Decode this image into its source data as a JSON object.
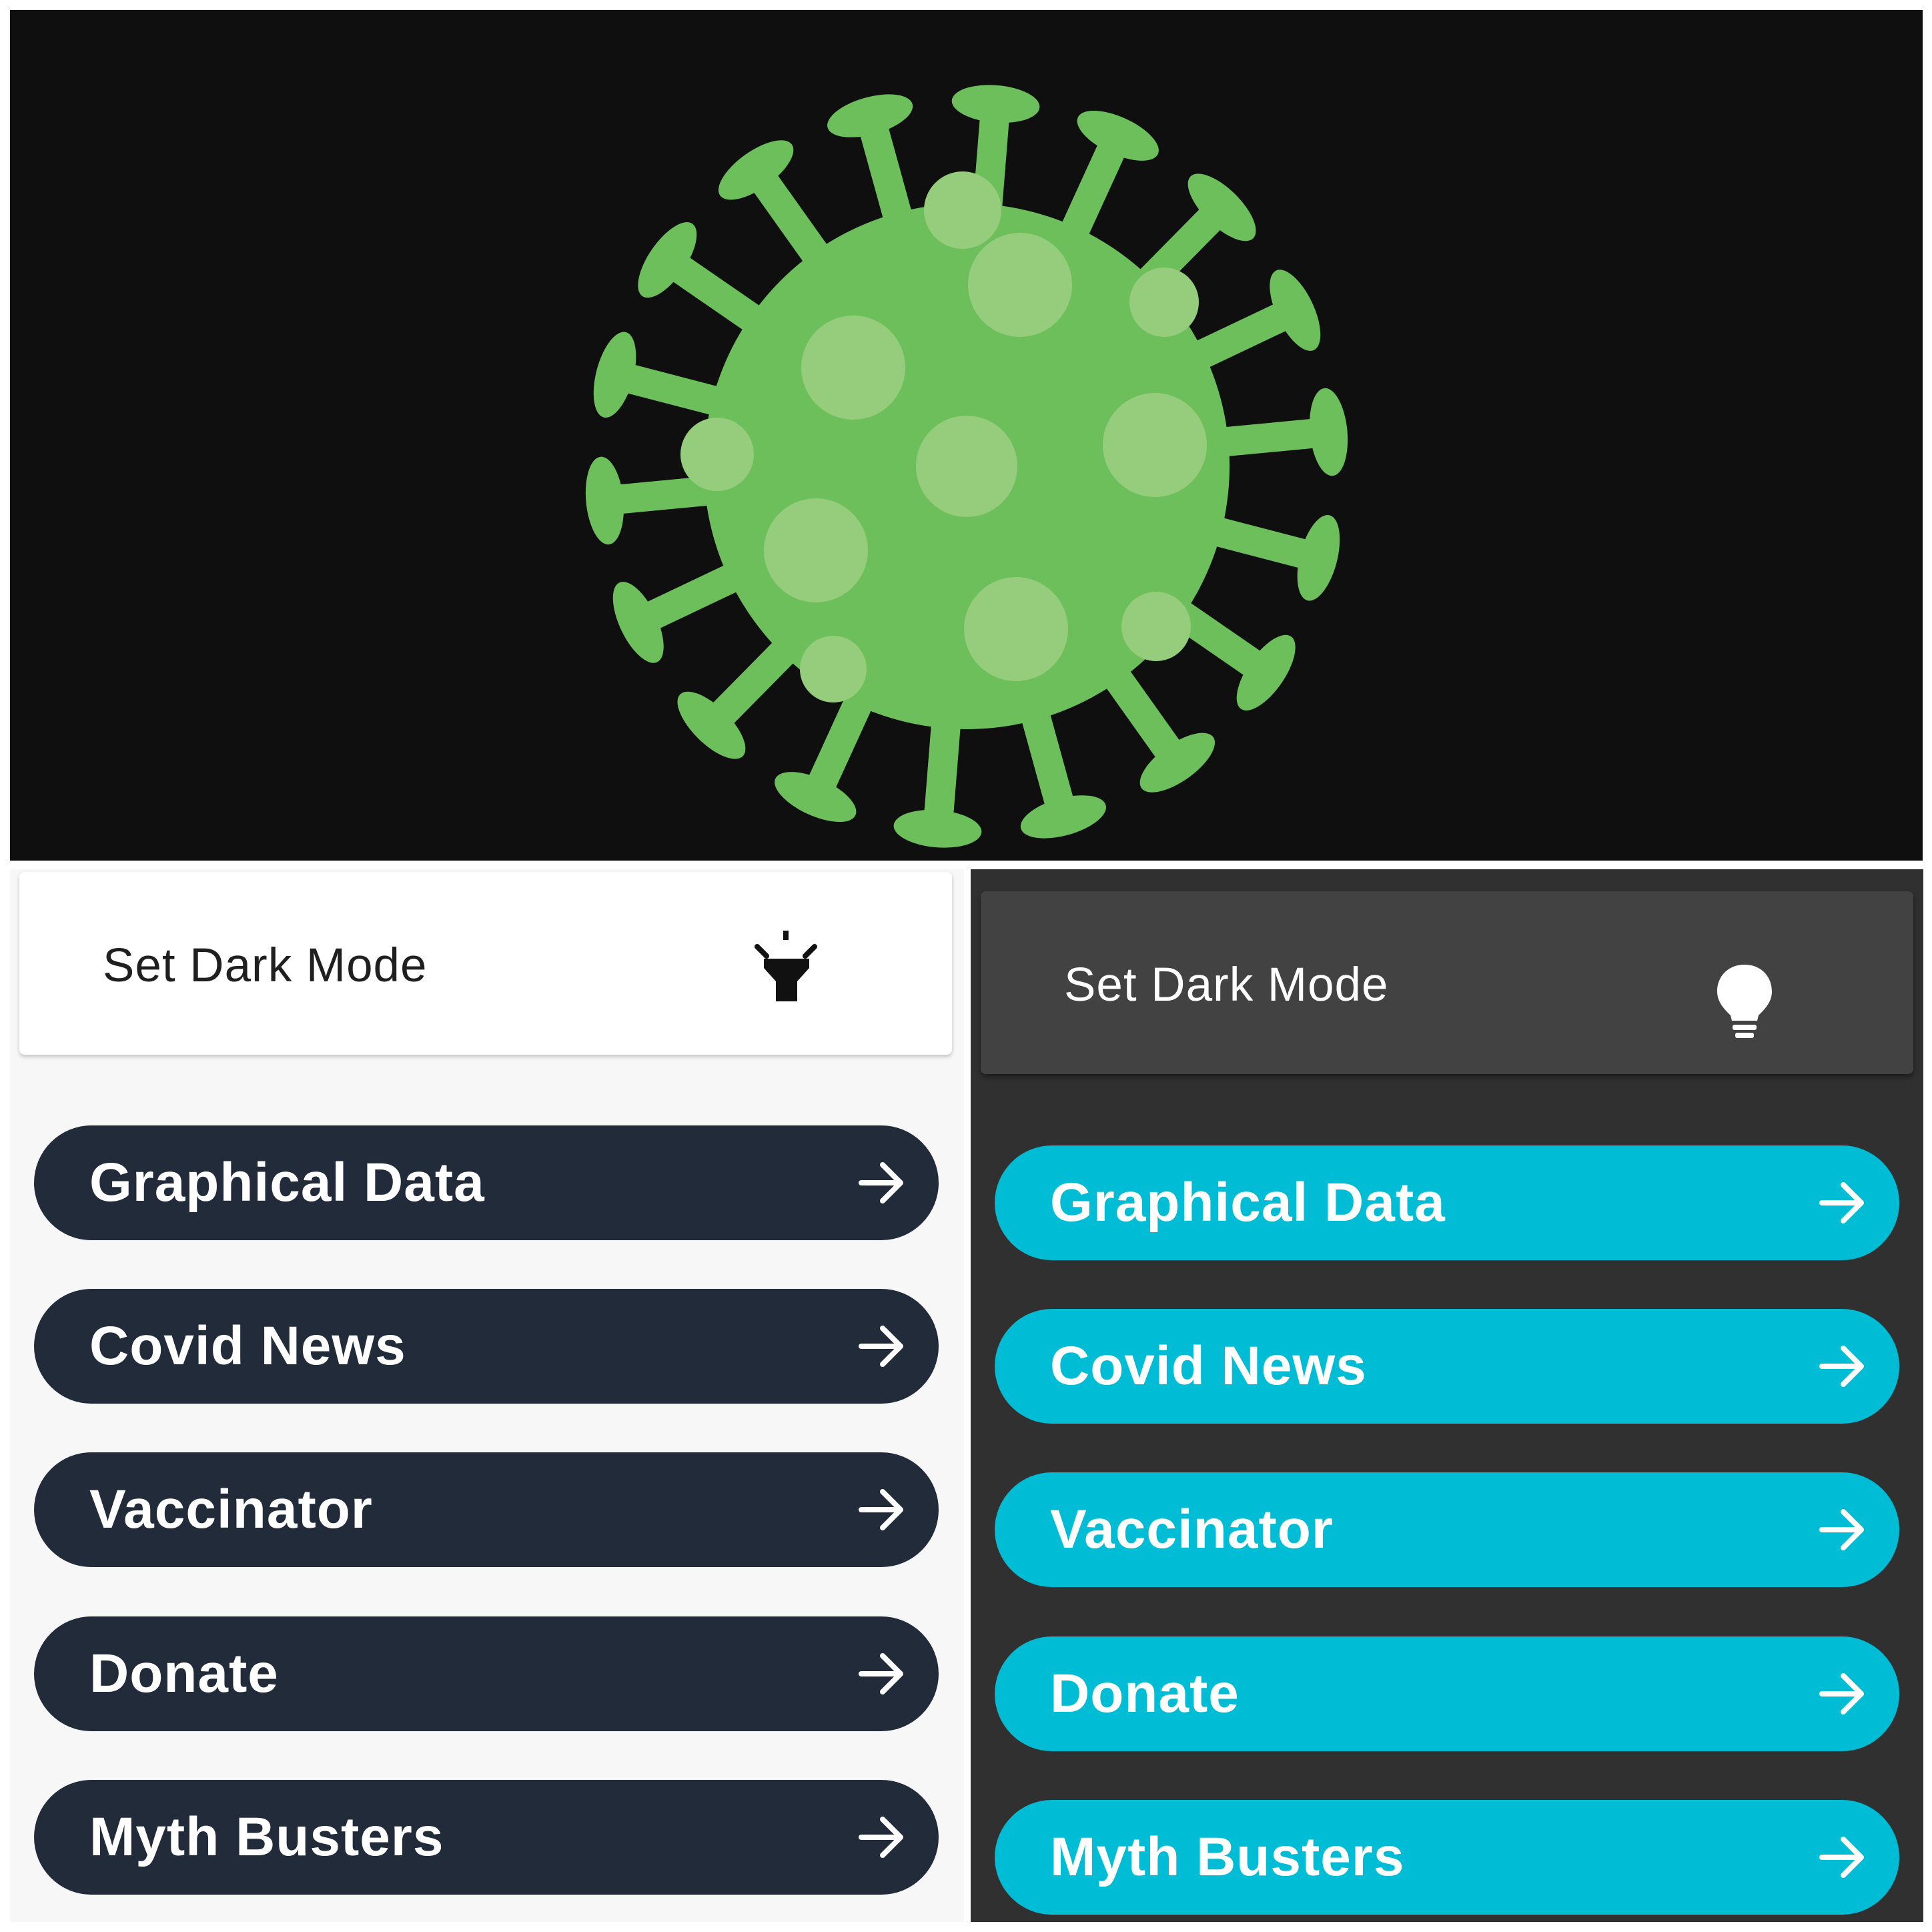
{
  "colors": {
    "banner_bg": "#0f0f0f",
    "virus_green": "#6cbf5a",
    "virus_spots": "#96cd7c",
    "light_bg": "#f7f7f7",
    "light_card": "#ffffff",
    "light_button": "#222b3a",
    "dark_bg": "#303030",
    "dark_card": "#424242",
    "dark_button": "#00bcd4",
    "button_text": "#ffffff"
  },
  "banner": {
    "icon": "virus-icon"
  },
  "light_theme": {
    "toggle": {
      "label": "Set Dark Mode",
      "icon": "flashlight-icon"
    },
    "buttons": [
      {
        "label": "Graphical Data",
        "icon": "arrow-right-icon"
      },
      {
        "label": "Covid News",
        "icon": "arrow-right-icon"
      },
      {
        "label": "Vaccinator",
        "icon": "arrow-right-icon"
      },
      {
        "label": "Donate",
        "icon": "arrow-right-icon"
      },
      {
        "label": "Myth Busters",
        "icon": "arrow-right-icon"
      }
    ]
  },
  "dark_theme": {
    "toggle": {
      "label": "Set Dark Mode",
      "icon": "lightbulb-icon"
    },
    "buttons": [
      {
        "label": "Graphical Data",
        "icon": "arrow-right-icon"
      },
      {
        "label": "Covid News",
        "icon": "arrow-right-icon"
      },
      {
        "label": "Vaccinator",
        "icon": "arrow-right-icon"
      },
      {
        "label": "Donate",
        "icon": "arrow-right-icon"
      },
      {
        "label": "Myth Busters",
        "icon": "arrow-right-icon"
      }
    ]
  }
}
